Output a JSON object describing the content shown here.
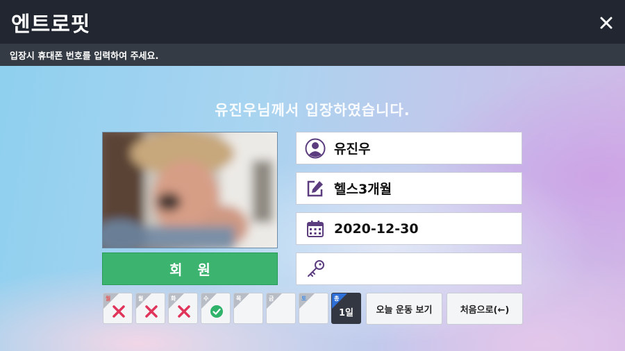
{
  "app": {
    "title": "엔트로핏"
  },
  "notice": "입장시 휴대폰 번호를 입력하여 주세요.",
  "welcome": "유진우님께서 입장하였습니다.",
  "member_button": "회원",
  "info": {
    "name": "유진우",
    "membership": "헬스3개월",
    "expiry_date": "2020-12-30",
    "locker": ""
  },
  "week": [
    {
      "label": "월",
      "status": "absent",
      "label_color": "#e35a5a"
    },
    {
      "label": "월",
      "status": "absent",
      "label_color": "#ffffff"
    },
    {
      "label": "화",
      "status": "absent",
      "label_color": "#ffffff"
    },
    {
      "label": "수",
      "status": "present",
      "label_color": "#ffffff"
    },
    {
      "label": "목",
      "status": "none",
      "label_color": "#ffffff"
    },
    {
      "label": "금",
      "status": "none",
      "label_color": "#ffffff"
    },
    {
      "label": "토",
      "status": "none",
      "label_color": "#4a90e2"
    }
  ],
  "today": {
    "label": "총",
    "count_text": "1일"
  },
  "buttons": {
    "today_workout": "오늘 운동 보기",
    "go_home": "처음으로(←)"
  },
  "colors": {
    "titlebar": "#212630",
    "accent_green": "#3cb36e",
    "icon_purple": "#5b3c7f",
    "absent_red": "#e0345a",
    "present_green": "#2fb36a"
  }
}
